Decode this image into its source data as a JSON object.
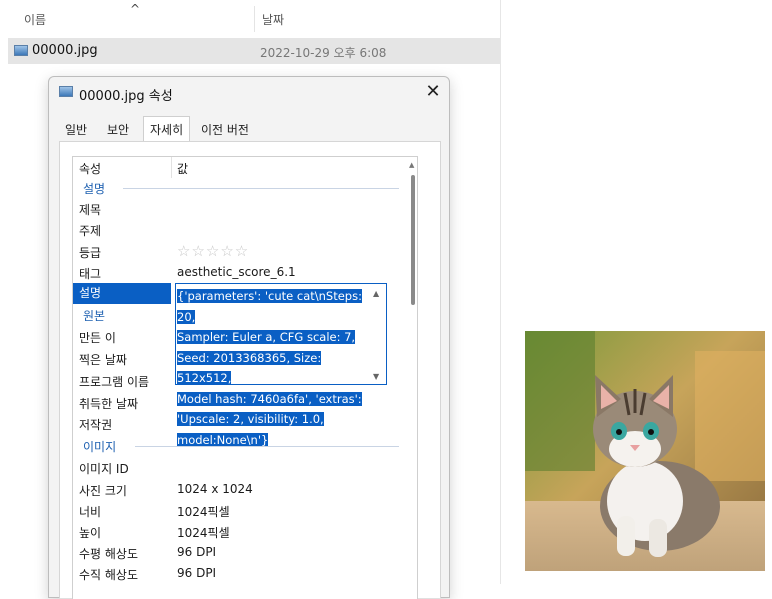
{
  "explorer": {
    "col_name": "이름",
    "col_date": "날짜",
    "file": {
      "name": "00000.jpg",
      "date": "2022-10-29 오후 6:08"
    }
  },
  "dialog": {
    "title": "00000.jpg 속성",
    "tabs": [
      "일반",
      "보안",
      "자세히",
      "이전 버전"
    ],
    "active_tab": "자세히",
    "columns": {
      "property": "속성",
      "value": "값"
    },
    "sections": {
      "description": "설명",
      "origin": "원본",
      "image": "이미지"
    },
    "fields": {
      "title": "제목",
      "subject": "주제",
      "rating": "등급",
      "rating_stars": "☆☆☆☆☆",
      "tags": "태그",
      "tags_value": "aesthetic_score_6.1",
      "comments": "설명",
      "comments_value": [
        "{'parameters': 'cute cat\\nSteps: 20,",
        "Sampler: Euler a, CFG scale: 7,",
        "Seed: 2013368365, Size: 512x512,",
        "Model hash: 7460a6fa', 'extras':",
        "'Upscale: 2, visibility: 1.0,",
        "model:None\\n'}"
      ],
      "author": "만든 이",
      "date_taken": "찍은 날짜",
      "program": "프로그램 이름",
      "date_acquired": "취득한 날짜",
      "copyright": "저작권",
      "image_id": "이미지 ID",
      "dimensions": "사진 크기",
      "dimensions_value": "1024 x 1024",
      "width": "너비",
      "width_value": "1024픽셀",
      "height": "높이",
      "height_value": "1024픽셀",
      "h_res": "수평 해상도",
      "h_res_value": "96 DPI",
      "v_res": "수직 해상도",
      "v_res_value": "96 DPI"
    }
  },
  "colors": {
    "selection": "#0a5fc4",
    "section_label": "#1c5fb0"
  }
}
